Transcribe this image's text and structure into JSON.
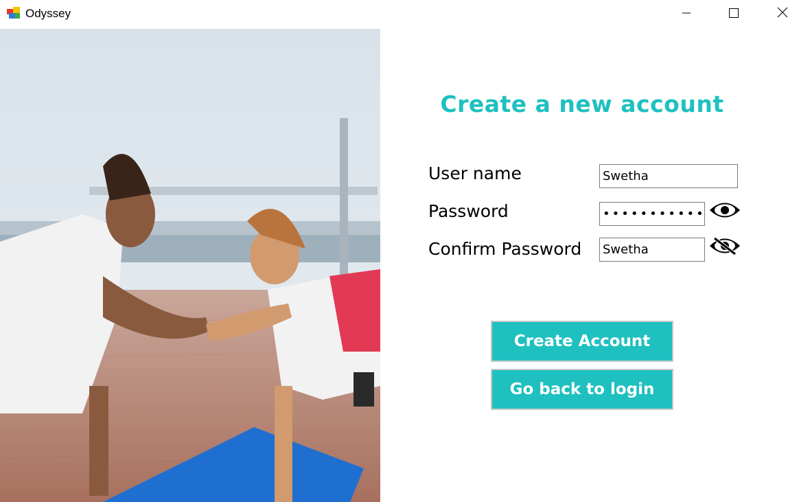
{
  "window": {
    "title": "Odyssey"
  },
  "form": {
    "heading": "Create a new account",
    "username_label": "User name",
    "username_value": "Swetha",
    "password_label": "Password",
    "password_value": "••••••••••••",
    "confirm_label": "Confirm Password",
    "confirm_value": "Swetha"
  },
  "buttons": {
    "create": "Create Account",
    "back": "Go back to login"
  },
  "icons": {
    "app": "app-logo-icon",
    "minimize": "minimize-icon",
    "maximize": "maximize-icon",
    "close": "close-icon",
    "show_password": "eye-icon",
    "hide_password": "eye-slash-icon"
  },
  "colors": {
    "accent": "#1fc0c0"
  }
}
